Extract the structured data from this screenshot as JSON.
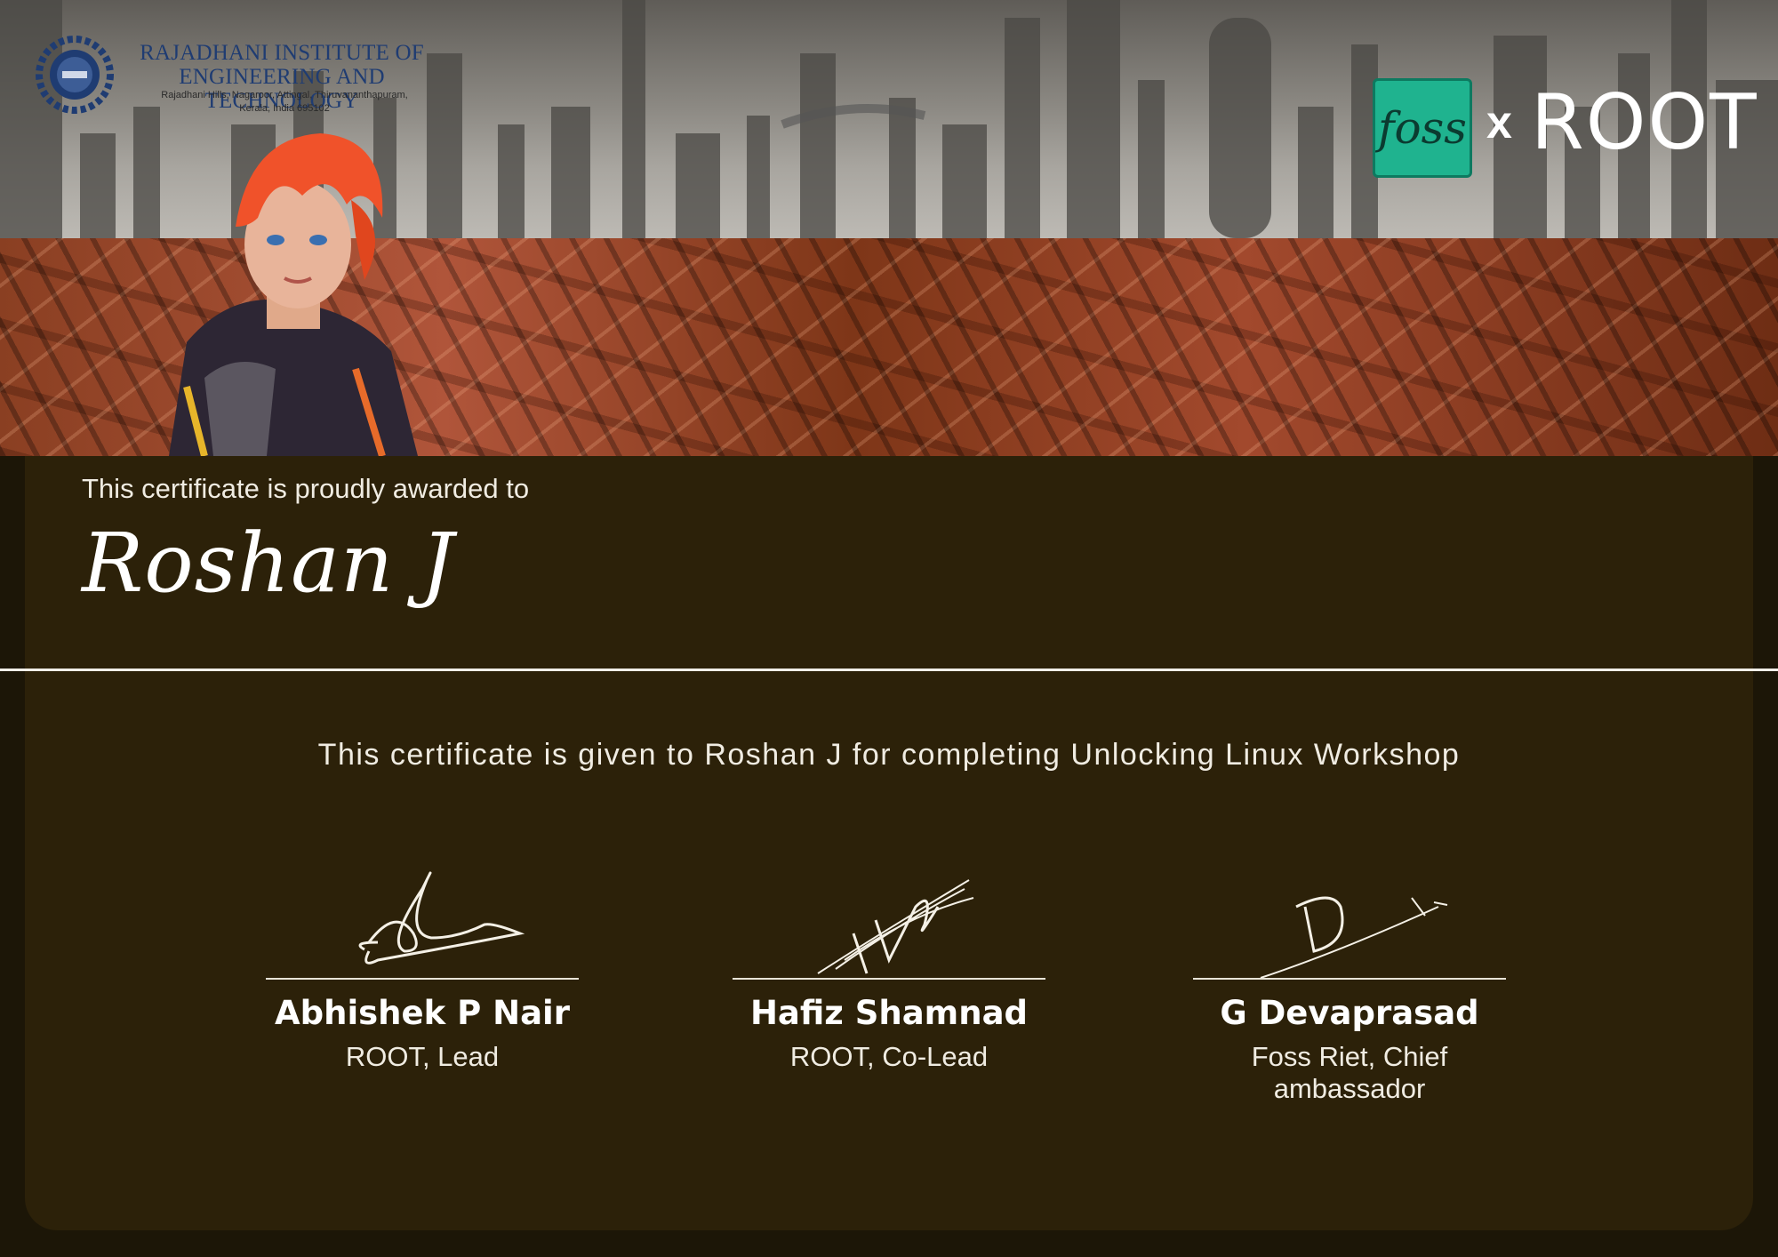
{
  "institution": {
    "name_line1": "RAJADHANI INSTITUTE OF",
    "name_line2": "ENGINEERING AND TECHNOLOGY",
    "address_line1": "Rajadhani Hills, Nagaroor, Attingal, Thiruvananthapuram,",
    "address_line2": "Kerala, India 695102"
  },
  "partner_logos": {
    "foss": "foss",
    "separator": "x",
    "root": "ROOT"
  },
  "certificate": {
    "awarded_label": "This certificate is proudly awarded to",
    "recipient_name": "Roshan J",
    "statement": "This certificate is given to Roshan J for completing Unlocking Linux Workshop"
  },
  "signatories": [
    {
      "name": "Abhishek P Nair",
      "role": "ROOT, Lead"
    },
    {
      "name": "Hafiz Shamnad",
      "role": "ROOT, Co-Lead"
    },
    {
      "name": "G Devaprasad",
      "role": "Foss Riet, Chief ambassador"
    }
  ],
  "colors": {
    "panel": "#2c2109",
    "foil": "#a2492d",
    "foss_green": "#1fb38f",
    "institution_blue": "#1f3c72"
  }
}
